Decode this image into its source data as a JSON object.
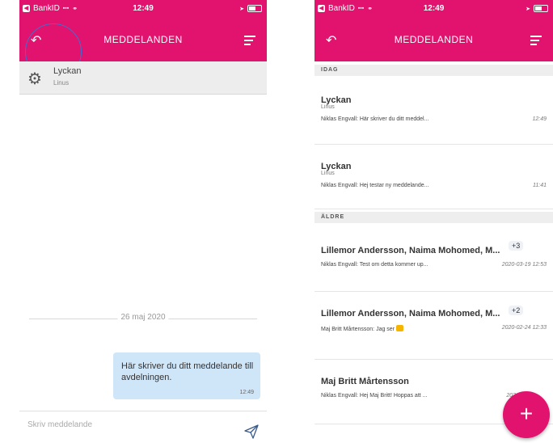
{
  "status": {
    "carrier": "BankID",
    "time": "12:49"
  },
  "left": {
    "header_title": "MEDDELANDEN",
    "thread": {
      "name": "Lyckan",
      "subtitle": "Linus"
    },
    "date_separator": "26 maj 2020",
    "message": {
      "text": "Här skriver du ditt meddelande till avdelningen.",
      "time": "12:49"
    },
    "compose_placeholder": "Skriv meddelande"
  },
  "right": {
    "header_title": "MEDDELANDEN",
    "sections": [
      "IDAG",
      "ÄLDRE"
    ],
    "conversations": [
      {
        "name": "Lyckan",
        "subtitle": "Linus",
        "preview": "Niklas Engvall: Här skriver du ditt meddel...",
        "time": "12:49"
      },
      {
        "name": "Lyckan",
        "subtitle": "Linus",
        "preview": "Niklas Engvall: Hej testar ny meddelande...",
        "time": "11:41"
      },
      {
        "name": "Lillemor Andersson, Naima Mohomed, M...",
        "badge": "+3",
        "preview": "Niklas Engvall: Test om detta kommer up...",
        "time": "2020-03-19 12:53"
      },
      {
        "name": "Lillemor Andersson, Naima Mohomed, M...",
        "badge": "+2",
        "preview": "Maj Britt Mårtensson: Jag ser",
        "time": "2020-02-24 12:33"
      },
      {
        "name": "Maj Britt Mårtensson",
        "preview": "Niklas Engvall: Hej Maj Britt! Hoppas att ...",
        "time": "202"
      }
    ],
    "fab_label": "+"
  },
  "colors": {
    "brand": "#e2136e",
    "bubble": "#cfe5f8",
    "highlight_circle": "#3f6fd0"
  },
  "icons": [
    "back-arrow-icon",
    "menu-icon",
    "gear-icon",
    "send-icon",
    "thumbs-up-icon",
    "wifi-icon",
    "battery-icon"
  ]
}
